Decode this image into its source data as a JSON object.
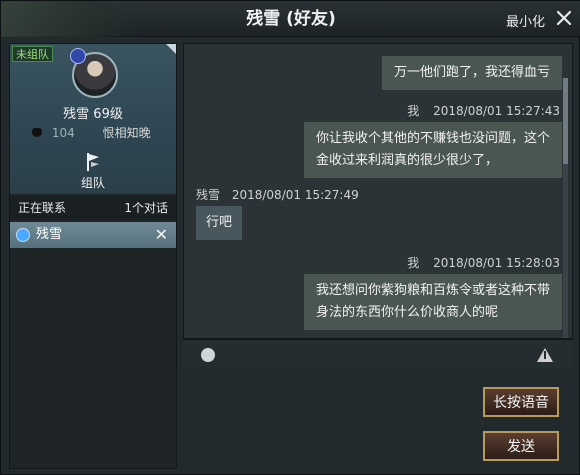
{
  "window": {
    "title": "残雪 (好友)",
    "minimize_label": "最小化"
  },
  "profile": {
    "team_status": "未组队",
    "name": "残雪",
    "level": "69级",
    "friendliness": "104",
    "relation": "恨相知晚",
    "team_button_label": "组队"
  },
  "contacts": {
    "header_left": "正在联系",
    "header_right": "1个对话",
    "items": [
      {
        "name": "残雪"
      }
    ]
  },
  "messages": [
    {
      "side": "right",
      "sender": "",
      "time": "",
      "text": "万一他们跑了，我还得血亏"
    },
    {
      "side": "right",
      "sender": "我",
      "time": "2018/08/01  15:27:43",
      "text": "你让我收个其他的不赚钱也没问题，这个金收过来利润真的很少很少了，",
      "line1": "你让我收个其他的不赚钱也没问题，这个",
      "line2": "金收过来利润真的很少很少了，"
    },
    {
      "side": "left",
      "sender": "残雪",
      "time": "2018/08/01  15:27:49",
      "text": "行吧"
    },
    {
      "side": "right",
      "sender": "我",
      "time": "2018/08/01  15:28:03",
      "text": "我还想问你紫狗粮和百炼令或者这种不带身法的东西你什么价收商人的呢",
      "line1": "我还想问你紫狗粮和百炼令或者这种不带",
      "line2": "身法的东西你什么价收商人的呢"
    }
  ],
  "buttons": {
    "voice": "长按语音",
    "send": "发送"
  },
  "colors": {
    "button_border": "#b79b5c",
    "contact_selected": "#6f8a96",
    "team_badge_text": "#9ee07a"
  },
  "icons": {
    "close": "close-icon",
    "emoji": "emoji-icon",
    "report": "warning-icon",
    "team": "flag-icon",
    "level": "level-badge-icon",
    "friendliness": "heart-icon"
  }
}
